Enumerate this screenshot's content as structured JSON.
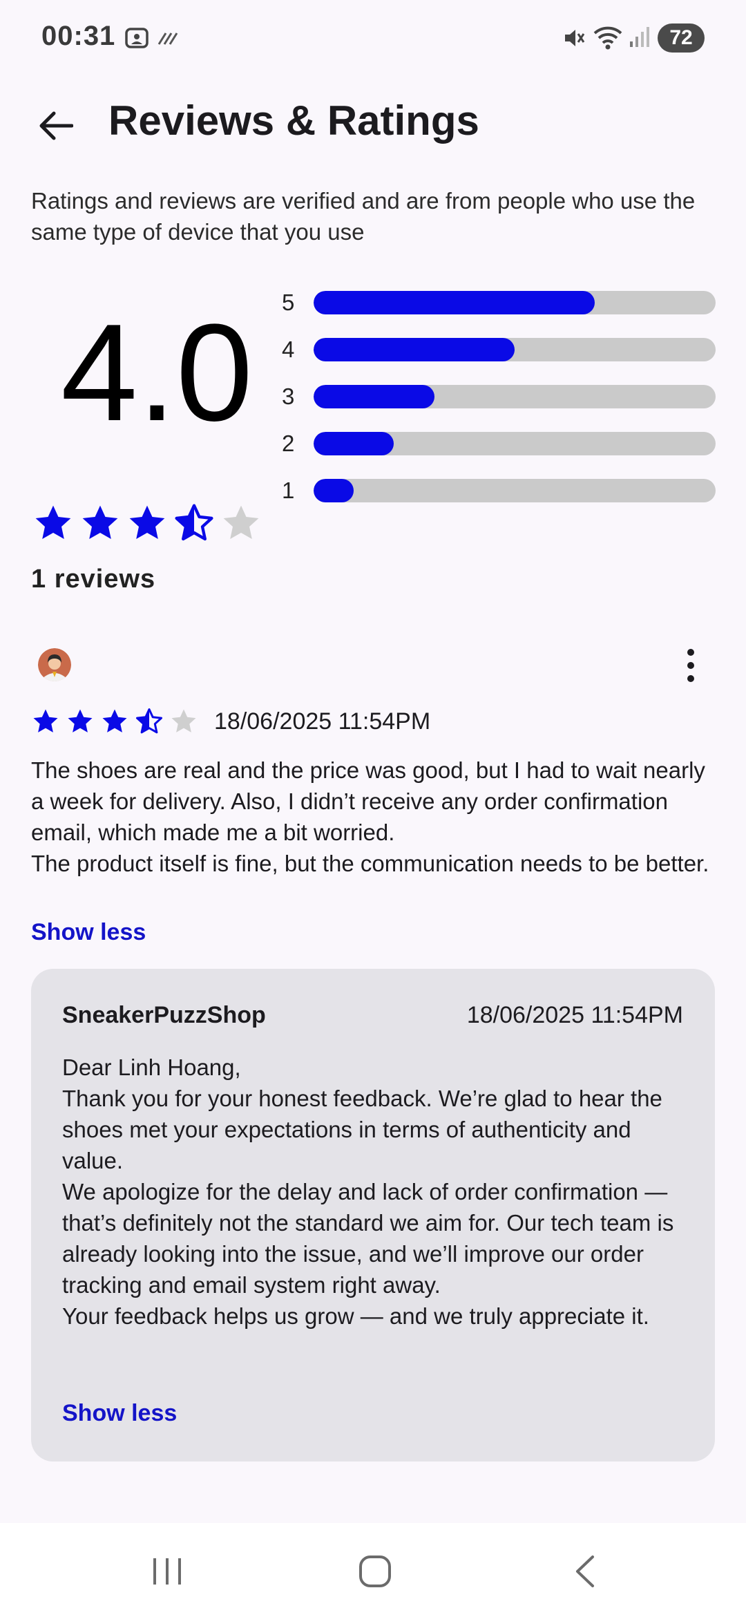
{
  "status_bar": {
    "time": "00:31",
    "battery": "72",
    "icons": [
      "screenshot-icon",
      "signal-stripes-icon",
      "mute-icon",
      "wifi-icon",
      "cell-signal-icon"
    ]
  },
  "header": {
    "title": "Reviews & Ratings"
  },
  "subtitle": "Ratings and reviews are verified and are from people who use the same type of device that you use",
  "summary": {
    "average": "4.0",
    "stars_shown": 3.5,
    "review_count_label": "1 reviews",
    "distribution": [
      {
        "label": "5",
        "fraction": 0.7
      },
      {
        "label": "4",
        "fraction": 0.5
      },
      {
        "label": "3",
        "fraction": 0.3
      },
      {
        "label": "2",
        "fraction": 0.2
      },
      {
        "label": "1",
        "fraction": 0.1
      }
    ]
  },
  "review": {
    "stars_shown": 3.5,
    "date": "18/06/2025 11:54PM",
    "body": "The shoes are real and the price was good, but I had to wait nearly a week for delivery. Also, I didn’t receive any order confirmation email, which made me a bit worried.\nThe product itself is fine, but the communication needs to be better.",
    "show_less_label": "Show less"
  },
  "reply": {
    "shop_name": "SneakerPuzzShop",
    "date": "18/06/2025 11:54PM",
    "body": "Dear Linh Hoang,\nThank you for your honest feedback. We’re glad to hear the shoes met your expectations in terms of authenticity and value.\nWe apologize for the delay and lack of order confirmation — that’s definitely not the standard we aim for. Our tech team is already looking into the issue, and we’ll improve our order tracking and email system right away.\nYour feedback helps us grow — and we truly appreciate it.",
    "show_less_label": "Show less"
  },
  "colors": {
    "accent": "#0a0ae6",
    "link": "#1414c8",
    "star_empty": "#cfcfcf",
    "bar_track": "#cacaca",
    "card_bg": "#e4e3e8"
  },
  "nav_bar": {
    "buttons": [
      "recents-icon",
      "home-icon",
      "back-nav-icon"
    ]
  }
}
